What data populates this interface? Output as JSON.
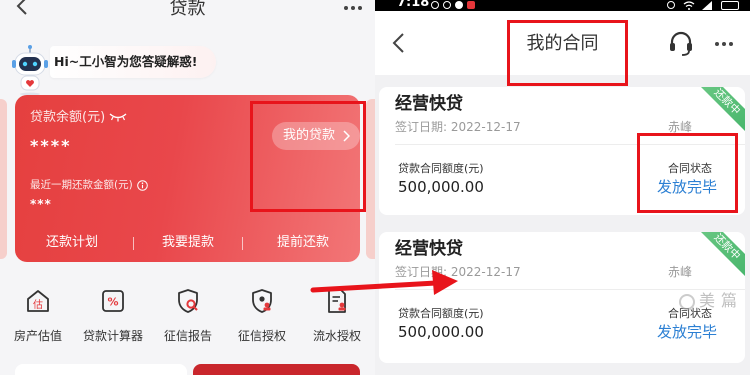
{
  "colors": {
    "annotation": "#e8141b",
    "card_red": "#e9474b",
    "card_red_light": "#f27677",
    "ribbon_green": "#45b46a",
    "status_blue": "#2b7fd3",
    "service_accent": "#e4393c"
  },
  "icons": {
    "back": "chevron-left-icon",
    "more": "more-dots-icon",
    "assistant": "robot-avatar-icon",
    "hide_balance": "eye-closed-icon",
    "info": "info-icon",
    "forward": "chevron-right-icon",
    "customer_service": "headset-icon",
    "watermark_logo": "watermark-logo-icon"
  },
  "loan_page": {
    "title": "贷款",
    "assistant_greeting": "Hi~工小智为您答疑解惑!",
    "card": {
      "balance_label": "贷款余额(元)",
      "balance_value": "****",
      "recent_payment_label": "最近一期还款金额(元)",
      "recent_payment_value": "***",
      "my_loans_button": "我的贷款",
      "actions": [
        "还款计划",
        "我要提款",
        "提前还款"
      ]
    },
    "services": [
      {
        "label": "房产估值",
        "icon": "house-valuation-icon",
        "glyph": "估"
      },
      {
        "label": "贷款计算器",
        "icon": "loan-calculator-icon",
        "glyph": "%"
      },
      {
        "label": "征信报告",
        "icon": "credit-report-icon"
      },
      {
        "label": "征信授权",
        "icon": "credit-authorization-icon"
      },
      {
        "label": "流水授权",
        "icon": "statement-authorization-icon"
      }
    ]
  },
  "contract_page": {
    "status_bar": {
      "time": "7:18"
    },
    "title": "我的合同",
    "contracts": [
      {
        "product": "经营快贷",
        "sign_date": "签订日期: 2022-12-17",
        "city": "赤峰",
        "ribbon": "还款中",
        "amount_label": "贷款合同额度(元)",
        "amount": "500,000.00",
        "status_label": "合同状态",
        "status": "发放完毕"
      },
      {
        "product": "经营快贷",
        "sign_date": "签订日期: 2022-12-17",
        "city": "赤峰",
        "ribbon": "还款中",
        "amount_label": "贷款合同额度(元)",
        "amount": "500,000.00",
        "status_label": "合同状态",
        "status": "发放完毕"
      }
    ],
    "watermark": "美篇"
  }
}
